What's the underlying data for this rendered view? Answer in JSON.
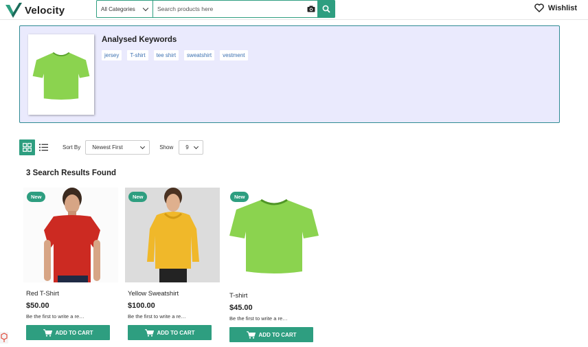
{
  "header": {
    "brand": "Velocity",
    "category_label": "All Categories",
    "search_placeholder": "Search products here",
    "wishlist_label": "Wishlist"
  },
  "analysis": {
    "title": "Analysed Keywords",
    "keywords": [
      "jersey",
      "T-shirt",
      "tee shirt",
      "sweatshirt",
      "vestment"
    ]
  },
  "toolbar": {
    "sort_label": "Sort By",
    "sort_value": "Newest First",
    "show_label": "Show",
    "show_value": "9"
  },
  "results_text": "3 Search Results Found",
  "products": [
    {
      "badge": "New",
      "name": "Red T-Shirt",
      "price": "$50.00",
      "review": "Be the first to write a re…",
      "cart_label": "ADD TO CART"
    },
    {
      "badge": "New",
      "name": "Yellow Sweatshirt",
      "price": "$100.00",
      "review": "Be the first to write a re…",
      "cart_label": "ADD TO CART"
    },
    {
      "badge": "New",
      "name": "T-shirt",
      "price": "$45.00",
      "review": "Be the first to write a re…",
      "cart_label": "ADD TO CART"
    }
  ],
  "colors": {
    "accent": "#2e9e80",
    "panel_bg": "#eaeafd",
    "keyword_text": "#3a6fb0"
  }
}
